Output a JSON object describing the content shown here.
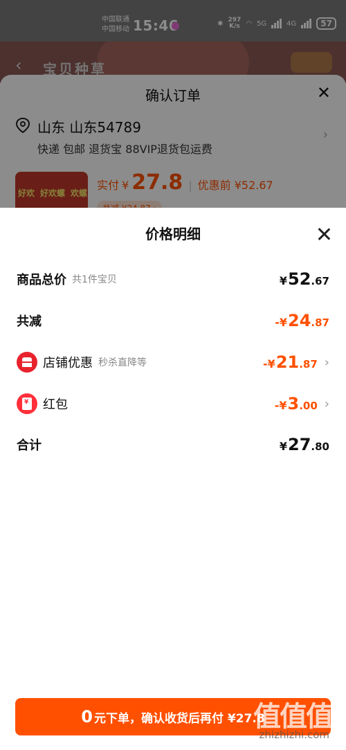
{
  "status_bar": {
    "carrier1": "中国联通",
    "carrier2": "中国移动",
    "time": "15:46",
    "speed_value": "297",
    "speed_unit": "K/s",
    "net1": "5G",
    "net2": "4G",
    "battery": "57"
  },
  "background_page": {
    "title": "宝贝种草"
  },
  "order": {
    "title": "确认订单",
    "address": "山东 山东54789",
    "services": "快递 包邮 退货宝 88VIP退货包运费",
    "paid_label": "实付",
    "paid_currency": "¥",
    "paid_amount": "27.8",
    "pre_discount": "优惠前 ¥52.67",
    "discount_pill": "共减 ¥24.87 ›",
    "product_text": [
      "好欢",
      "好欢螺",
      "欢螺"
    ]
  },
  "price_detail": {
    "title": "价格明细",
    "rows": [
      {
        "label": "商品总价",
        "hint": "共1件宝贝",
        "currency": "¥",
        "int": "52",
        "dec": ".67"
      },
      {
        "label": "共减",
        "hint": "",
        "currency": "-¥",
        "int": "24",
        "dec": ".87"
      },
      {
        "label": "店铺优惠",
        "hint": "秒杀直降等",
        "currency": "-¥",
        "int": "21",
        "dec": ".87"
      },
      {
        "label": "红包",
        "hint": "",
        "currency": "-¥",
        "int": "3",
        "dec": ".00"
      },
      {
        "label": "合计",
        "hint": "",
        "currency": "¥",
        "int": "27",
        "dec": ".80"
      }
    ]
  },
  "cta": {
    "zero": "0",
    "text": "元下单，确认收货后再付 ¥27.8"
  },
  "watermark": {
    "logo": "值值值",
    "url": "zhizhizhi.com"
  },
  "colors": {
    "accent": "#ff5000",
    "store_icon": "#e8232d",
    "redpacket_icon": "#ff2f3a"
  }
}
